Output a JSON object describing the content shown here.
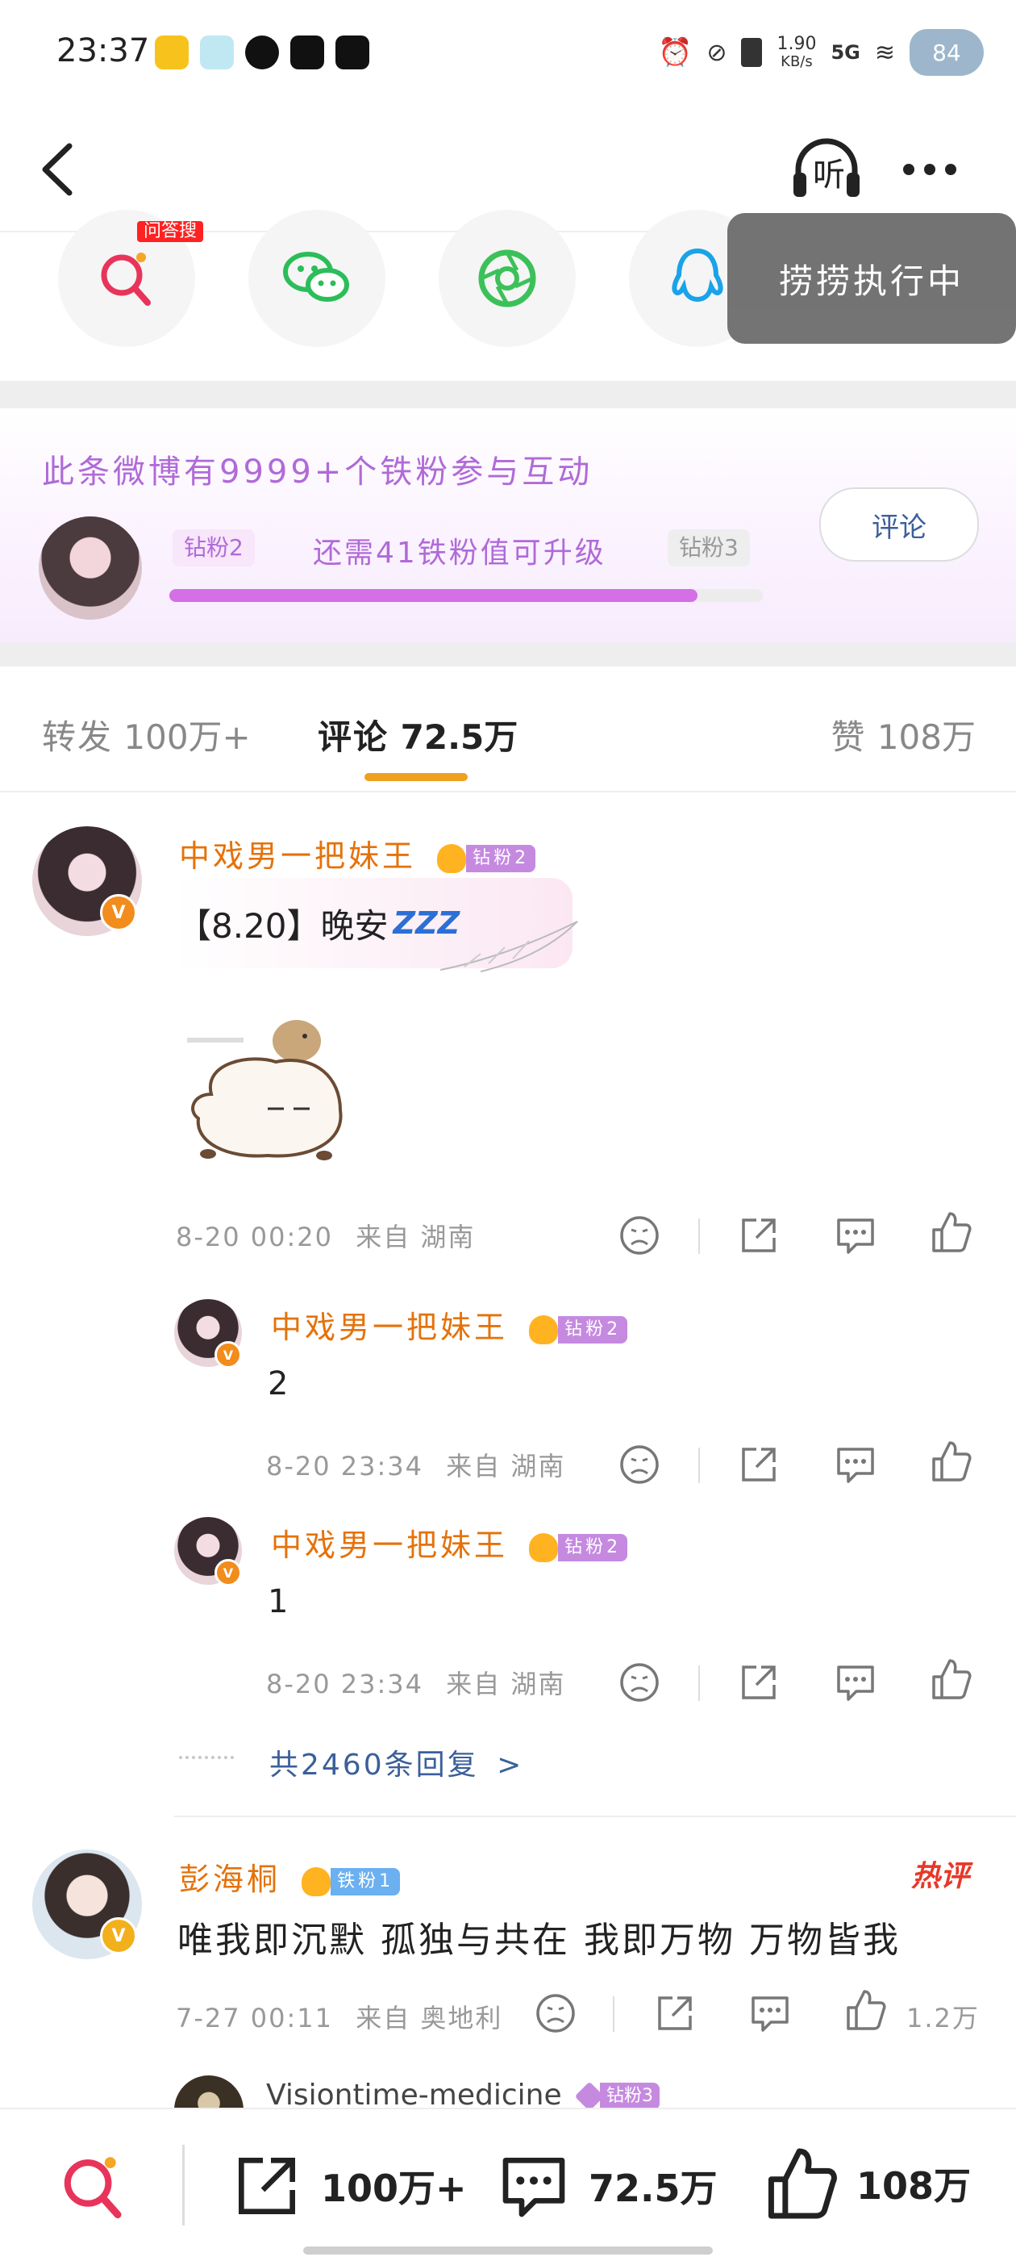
{
  "status_bar": {
    "time": "23:37",
    "network_speed": "1.90",
    "network_unit": "KB/s",
    "signal": "5G",
    "battery": "84"
  },
  "nav": {
    "listen_label": "听"
  },
  "share_row": {
    "badge": "问答搜"
  },
  "toast": "捞捞执行中",
  "fans_card": {
    "title": "此条微博有9999+个铁粉参与互动",
    "current_level": "钻粉2",
    "next_level": "钻粉3",
    "need_text": "还需41铁粉值可升级",
    "comment_button": "评论",
    "progress": 0.89
  },
  "tabs": {
    "repost_label": "转发",
    "repost_count": "100万+",
    "comment_label": "评论",
    "comment_count": "72.5万",
    "like_label": "赞",
    "like_count": "108万"
  },
  "comment1": {
    "username": "中戏男一把妹王",
    "level": "钻粉2",
    "crown_num": "5",
    "vbadge": "V",
    "text": "【8.20】晚安",
    "zzz": "ZZZ",
    "time": "8-20 00:20",
    "location": "来自 湖南",
    "replies": [
      {
        "username": "中戏男一把妹王",
        "level": "钻粉2",
        "text": "2",
        "time": "8-20 23:34",
        "location": "来自 湖南"
      },
      {
        "username": "中戏男一把妹王",
        "level": "钻粉2",
        "text": "1",
        "time": "8-20 23:34",
        "location": "来自 湖南"
      }
    ],
    "reply_total": "共2460条回复",
    "reply_chevron": ">"
  },
  "comment2": {
    "username": "彭海桐",
    "level": "铁粉1",
    "hot_label": "热评",
    "text": "唯我即沉默 孤独与共在 我即万物 万物皆我",
    "time": "7-27 00:11",
    "location": "来自 奥地利",
    "like_count": "1.2万"
  },
  "comment3": {
    "username": "Visiontime-medicine",
    "level": "钻粉3"
  },
  "bottom_bar": {
    "repost_count": "100万+",
    "comment_count": "72.5万",
    "like_count": "108万"
  }
}
